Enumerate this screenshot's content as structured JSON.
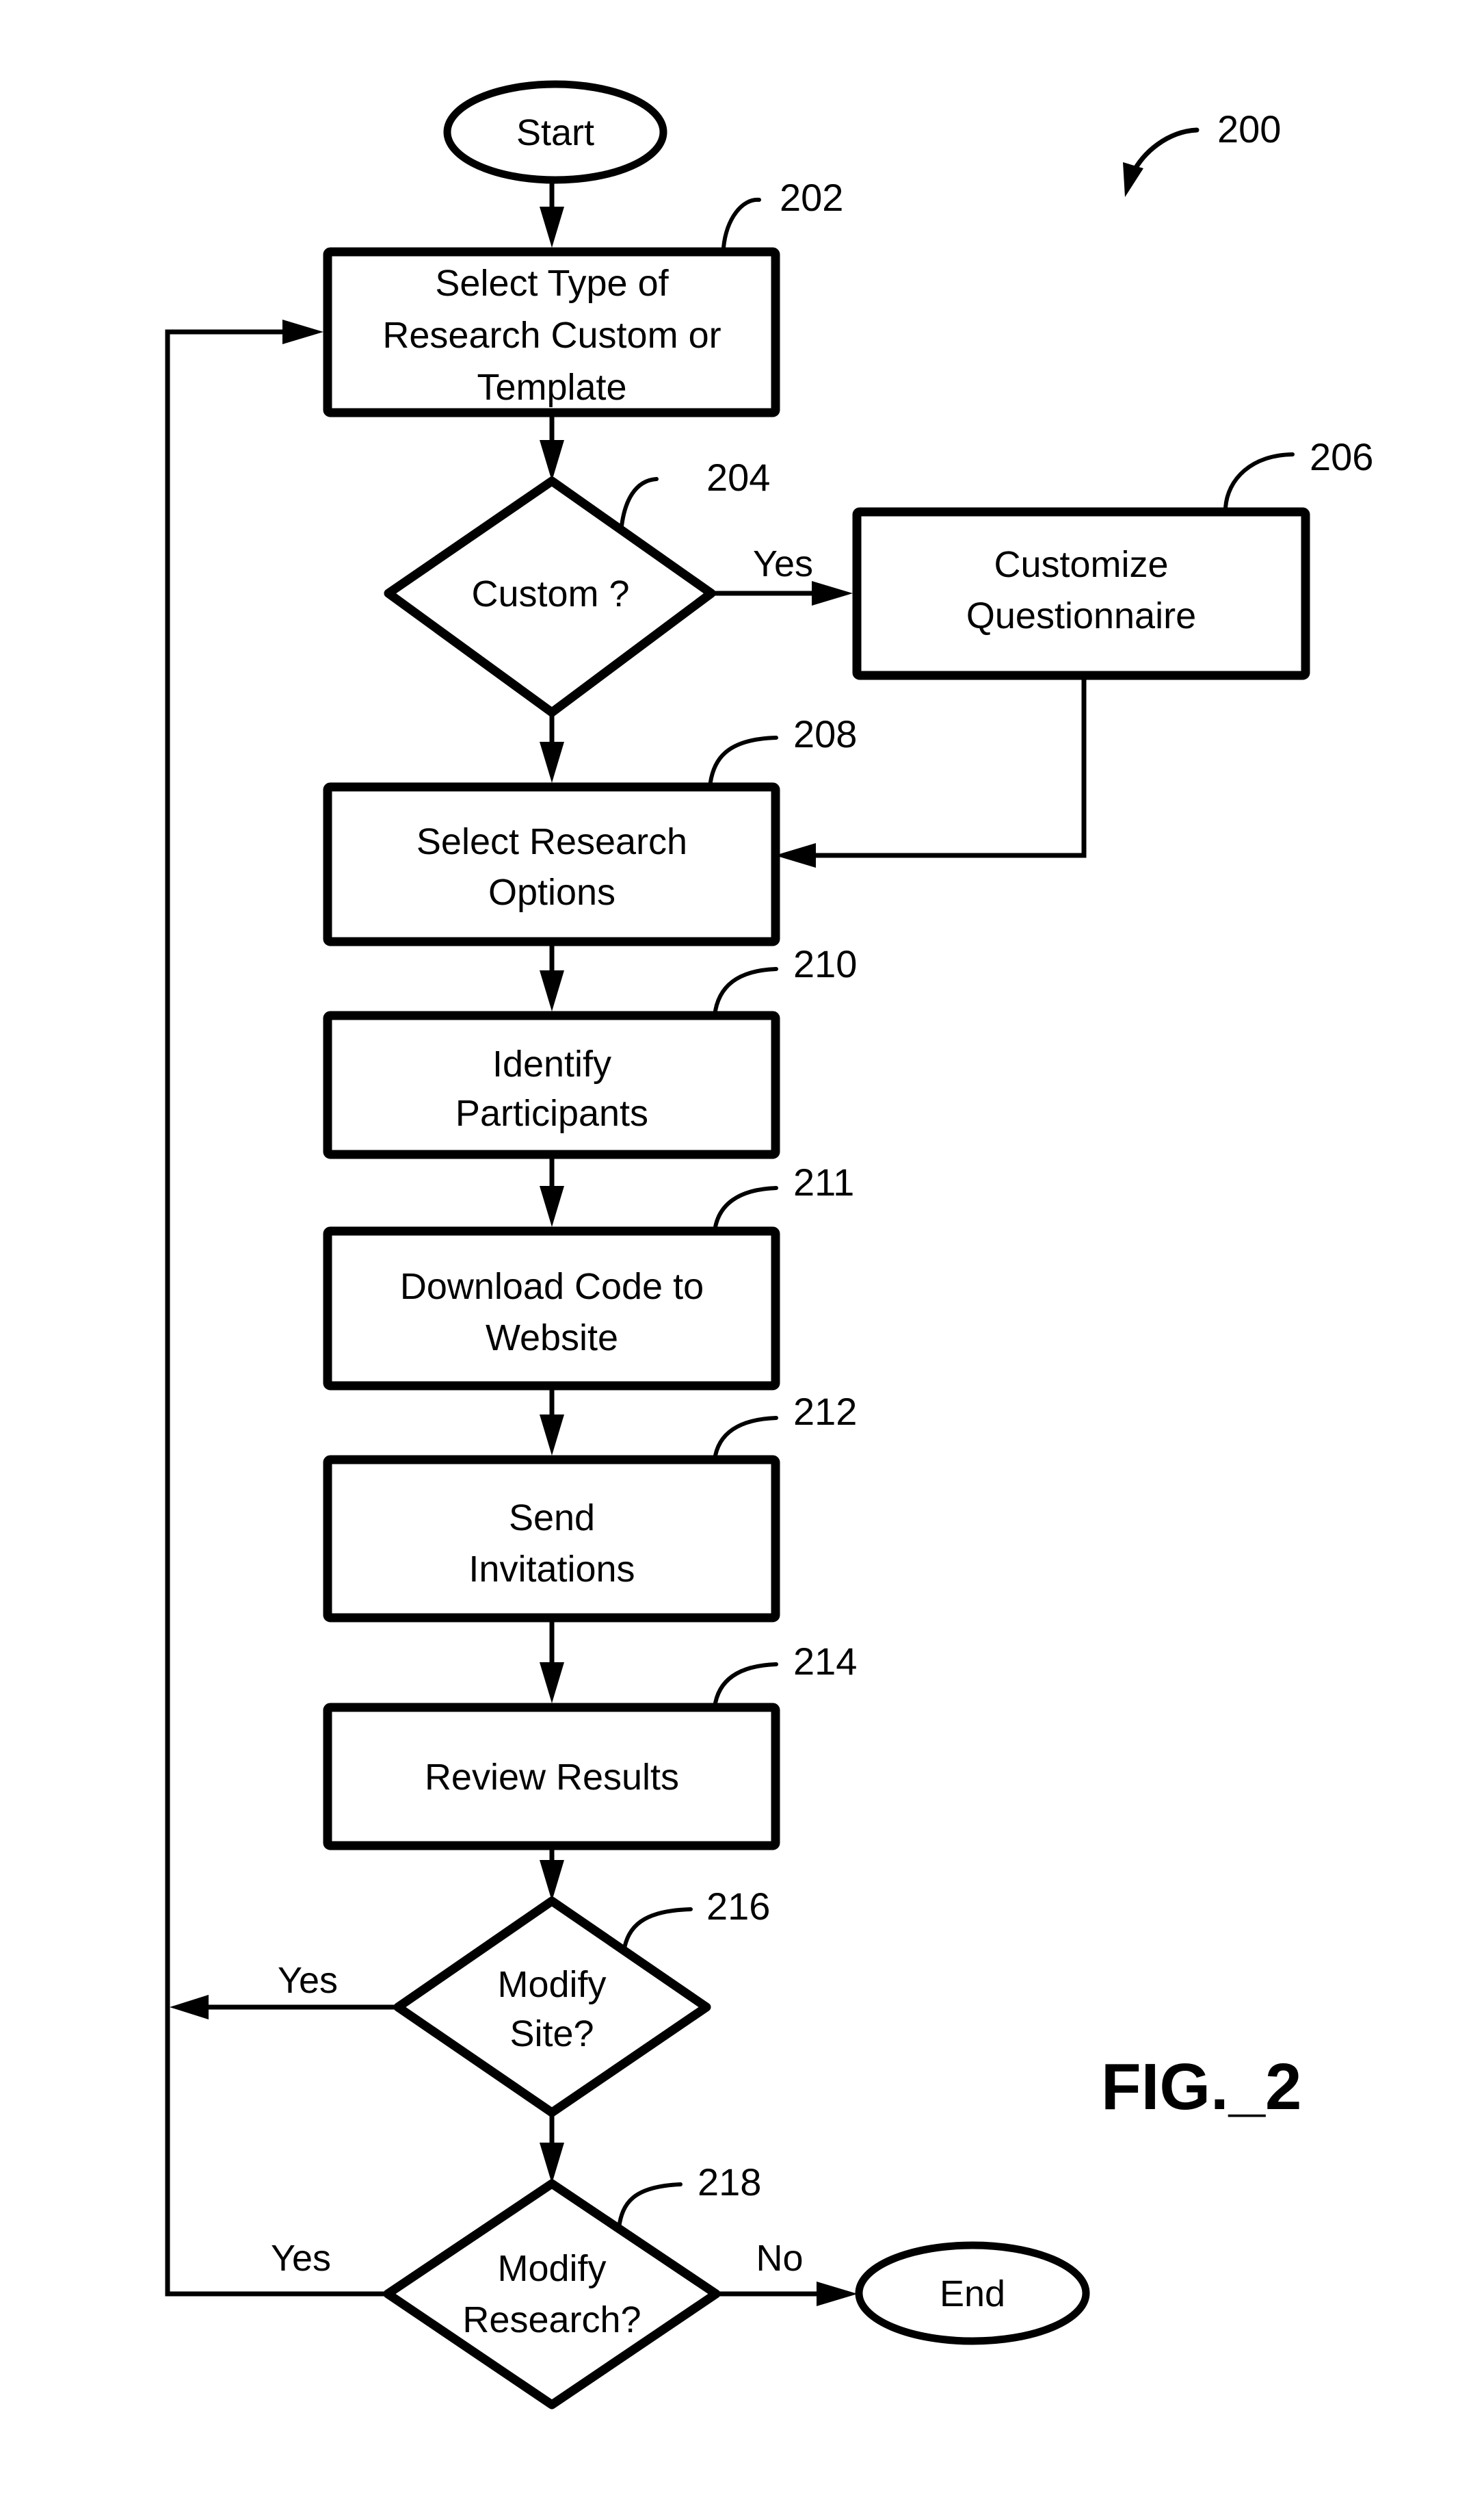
{
  "figure": {
    "label": "FIG._2",
    "reference": "200"
  },
  "nodes": [
    {
      "id": "start",
      "type": "terminal",
      "lines": [
        "Start"
      ]
    },
    {
      "id": "202",
      "type": "process",
      "ref": "202",
      "lines": [
        "Select Type of",
        "Research Custom or",
        "Template"
      ]
    },
    {
      "id": "204",
      "type": "decision",
      "ref": "204",
      "lines": [
        "Custom ?"
      ]
    },
    {
      "id": "206",
      "type": "process",
      "ref": "206",
      "lines": [
        "Customize",
        "Questionnaire"
      ]
    },
    {
      "id": "208",
      "type": "process",
      "ref": "208",
      "lines": [
        "Select Research",
        "Options"
      ]
    },
    {
      "id": "210",
      "type": "process",
      "ref": "210",
      "lines": [
        "Identify",
        "Participants"
      ]
    },
    {
      "id": "211",
      "type": "process",
      "ref": "211",
      "lines": [
        "Download Code to",
        "Website"
      ]
    },
    {
      "id": "212",
      "type": "process",
      "ref": "212",
      "lines": [
        "Send",
        "Invitations"
      ]
    },
    {
      "id": "214",
      "type": "process",
      "ref": "214",
      "lines": [
        "Review Results"
      ]
    },
    {
      "id": "216",
      "type": "decision",
      "ref": "216",
      "lines": [
        "Modify",
        "Site?"
      ]
    },
    {
      "id": "218",
      "type": "decision",
      "ref": "218",
      "lines": [
        "Modify",
        "Research?"
      ]
    },
    {
      "id": "end",
      "type": "terminal",
      "lines": [
        "End"
      ]
    }
  ],
  "edges": [
    {
      "from": "start",
      "to": "202",
      "label": ""
    },
    {
      "from": "202",
      "to": "204",
      "label": ""
    },
    {
      "from": "204",
      "to": "206",
      "label": "Yes"
    },
    {
      "from": "204",
      "to": "208",
      "label": ""
    },
    {
      "from": "206",
      "to": "208",
      "label": ""
    },
    {
      "from": "208",
      "to": "210",
      "label": ""
    },
    {
      "from": "210",
      "to": "211",
      "label": ""
    },
    {
      "from": "211",
      "to": "212",
      "label": ""
    },
    {
      "from": "212",
      "to": "214",
      "label": ""
    },
    {
      "from": "214",
      "to": "216",
      "label": ""
    },
    {
      "from": "216",
      "to": "202",
      "label": "Yes"
    },
    {
      "from": "216",
      "to": "218",
      "label": ""
    },
    {
      "from": "218",
      "to": "202",
      "label": "Yes"
    },
    {
      "from": "218",
      "to": "end",
      "label": "No"
    }
  ]
}
